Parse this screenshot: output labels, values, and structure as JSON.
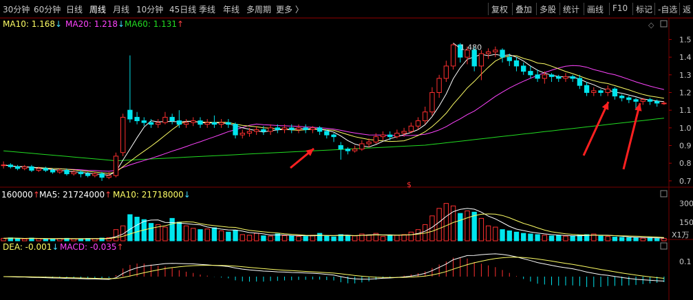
{
  "periods": [
    "30分钟",
    "60分钟",
    "日线",
    "周线",
    "月线",
    "10分钟",
    "45日线",
    "季线",
    "年线",
    "多周期",
    "更多 〉"
  ],
  "active_period": "周线",
  "toolbar": [
    "复权",
    "叠加",
    "多股",
    "统计",
    "画线",
    "F10",
    "标记",
    "-自选",
    "返"
  ],
  "ma_legend": {
    "ma10": {
      "label": "MA10: 1.168",
      "arrow": "↓",
      "color": "#ffff66"
    },
    "ma20": {
      "label": "MA20: 1.218",
      "arrow": "↓",
      "color": "#ff44ff"
    },
    "ma60": {
      "label": "MA60: 1.131",
      "arrow": "↑",
      "color": "#22dd22"
    }
  },
  "vol_legend": {
    "vol": {
      "label": "160000",
      "arrow": "↑",
      "color": "#ffffff"
    },
    "ma5": {
      "label": "MA5: 21724000",
      "arrow": "↑",
      "color": "#ffffff"
    },
    "ma10": {
      "label": "MA10: 21718000",
      "arrow": "↓",
      "color": "#ffff66"
    }
  },
  "macd_legend": {
    "dea": {
      "label": "DEA: -0.001",
      "arrow": "↓",
      "color": "#ffff66"
    },
    "macd": {
      "label": "MACD: -0.035",
      "arrow": "↑",
      "color": "#ff44ff"
    }
  },
  "price_axis": [
    "1.5",
    "1.4",
    "1.3",
    "1.2",
    "1.1",
    "1.0",
    "0.9",
    "0.8",
    "0.7"
  ],
  "vol_axis": [
    "300",
    "150"
  ],
  "vol_unit": "X1万",
  "macd_axis": [
    "0.1"
  ],
  "high_label": "1.480",
  "marker": "$",
  "colors": {
    "up": "#ff3030",
    "down": "#00e5ee",
    "ma10": "#ffff66",
    "ma20": "#ff44ff",
    "ma60": "#22dd22",
    "white": "#ffffff"
  },
  "chart_data": {
    "type": "candlestick",
    "series": [
      {
        "name": "MA10",
        "last": 1.168
      },
      {
        "name": "MA20",
        "last": 1.218
      },
      {
        "name": "MA60",
        "last": 1.131
      }
    ],
    "high_value": 1.48,
    "ylim": [
      0.68,
      1.56
    ],
    "candles": [
      [
        0.79,
        0.79,
        0.77,
        0.81
      ],
      [
        0.79,
        0.78,
        0.77,
        0.8
      ],
      [
        0.78,
        0.77,
        0.76,
        0.79
      ],
      [
        0.77,
        0.78,
        0.76,
        0.79
      ],
      [
        0.78,
        0.76,
        0.75,
        0.79
      ],
      [
        0.76,
        0.77,
        0.75,
        0.78
      ],
      [
        0.77,
        0.76,
        0.75,
        0.78
      ],
      [
        0.76,
        0.75,
        0.74,
        0.77
      ],
      [
        0.75,
        0.76,
        0.74,
        0.77
      ],
      [
        0.76,
        0.74,
        0.73,
        0.77
      ],
      [
        0.74,
        0.75,
        0.73,
        0.76
      ],
      [
        0.75,
        0.74,
        0.72,
        0.76
      ],
      [
        0.74,
        0.73,
        0.72,
        0.75
      ],
      [
        0.73,
        0.74,
        0.72,
        0.75
      ],
      [
        0.74,
        0.72,
        0.7,
        0.75
      ],
      [
        0.72,
        0.73,
        0.71,
        0.75
      ],
      [
        0.73,
        0.84,
        0.72,
        0.86
      ],
      [
        0.86,
        1.06,
        0.84,
        1.08
      ],
      [
        1.1,
        1.05,
        1.03,
        1.41
      ],
      [
        1.06,
        1.04,
        1.02,
        1.09
      ],
      [
        1.04,
        1.03,
        1.01,
        1.06
      ],
      [
        1.03,
        1.02,
        1.0,
        1.05
      ],
      [
        1.02,
        1.03,
        1.0,
        1.05
      ],
      [
        1.03,
        1.06,
        1.02,
        1.09
      ],
      [
        1.06,
        1.04,
        1.02,
        1.08
      ],
      [
        1.04,
        1.02,
        1.0,
        1.1
      ],
      [
        1.02,
        1.03,
        1.0,
        1.05
      ],
      [
        1.03,
        1.04,
        1.01,
        1.06
      ],
      [
        1.04,
        1.02,
        1.0,
        1.06
      ],
      [
        1.02,
        1.03,
        1.0,
        1.05
      ],
      [
        1.03,
        1.02,
        1.0,
        1.07
      ],
      [
        1.02,
        1.03,
        1.0,
        1.05
      ],
      [
        1.03,
        1.02,
        1.0,
        1.05
      ],
      [
        1.02,
        0.96,
        0.94,
        1.03
      ],
      [
        0.96,
        0.97,
        0.94,
        0.99
      ],
      [
        0.97,
        0.98,
        0.95,
        1.0
      ],
      [
        0.98,
        0.99,
        0.96,
        1.01
      ],
      [
        0.99,
        0.98,
        0.96,
        1.01
      ],
      [
        0.98,
        1.0,
        0.96,
        1.02
      ],
      [
        1.0,
        0.99,
        0.97,
        1.02
      ],
      [
        0.99,
        1.0,
        0.97,
        1.02
      ],
      [
        1.0,
        0.99,
        0.97,
        1.02
      ],
      [
        0.99,
        1.0,
        0.97,
        1.02
      ],
      [
        1.0,
        0.99,
        0.97,
        1.02
      ],
      [
        0.99,
        1.0,
        0.97,
        1.01
      ],
      [
        1.0,
        0.98,
        0.96,
        1.01
      ],
      [
        0.98,
        0.96,
        0.94,
        0.99
      ],
      [
        0.96,
        0.95,
        0.92,
        0.97
      ],
      [
        0.9,
        0.88,
        0.82,
        0.92
      ],
      [
        0.88,
        0.87,
        0.85,
        0.89
      ],
      [
        0.87,
        0.88,
        0.86,
        0.9
      ],
      [
        0.88,
        0.91,
        0.87,
        0.93
      ],
      [
        0.91,
        0.92,
        0.89,
        0.94
      ],
      [
        0.92,
        0.95,
        0.91,
        0.97
      ],
      [
        0.95,
        0.96,
        0.93,
        0.98
      ],
      [
        0.96,
        0.95,
        0.93,
        0.98
      ],
      [
        0.95,
        0.97,
        0.94,
        0.99
      ],
      [
        0.97,
        0.98,
        0.95,
        1.0
      ],
      [
        0.98,
        1.01,
        0.97,
        1.03
      ],
      [
        1.01,
        1.04,
        0.99,
        1.06
      ],
      [
        1.04,
        1.09,
        1.02,
        1.12
      ],
      [
        1.09,
        1.2,
        1.07,
        1.23
      ],
      [
        1.2,
        1.28,
        1.17,
        1.3
      ],
      [
        1.28,
        1.35,
        1.26,
        1.38
      ],
      [
        1.35,
        1.47,
        1.33,
        1.48
      ],
      [
        1.47,
        1.4,
        1.37,
        1.48
      ],
      [
        1.4,
        1.44,
        1.36,
        1.46
      ],
      [
        1.44,
        1.35,
        1.32,
        1.46
      ],
      [
        1.35,
        1.42,
        1.27,
        1.44
      ],
      [
        1.42,
        1.43,
        1.39,
        1.45
      ],
      [
        1.43,
        1.44,
        1.4,
        1.46
      ],
      [
        1.44,
        1.4,
        1.37,
        1.45
      ],
      [
        1.4,
        1.38,
        1.35,
        1.42
      ],
      [
        1.38,
        1.35,
        1.32,
        1.4
      ],
      [
        1.35,
        1.32,
        1.3,
        1.37
      ],
      [
        1.32,
        1.3,
        1.28,
        1.35
      ],
      [
        1.3,
        1.28,
        1.26,
        1.33
      ],
      [
        1.28,
        1.3,
        1.25,
        1.32
      ],
      [
        1.3,
        1.29,
        1.26,
        1.31
      ],
      [
        1.29,
        1.28,
        1.26,
        1.3
      ],
      [
        1.28,
        1.29,
        1.26,
        1.31
      ],
      [
        1.29,
        1.28,
        1.26,
        1.3
      ],
      [
        1.28,
        1.24,
        1.22,
        1.3
      ],
      [
        1.24,
        1.2,
        1.18,
        1.26
      ],
      [
        1.2,
        1.21,
        1.18,
        1.23
      ],
      [
        1.21,
        1.2,
        1.18,
        1.22
      ],
      [
        1.2,
        1.22,
        1.18,
        1.24
      ],
      [
        1.22,
        1.18,
        1.16,
        1.23
      ],
      [
        1.18,
        1.17,
        1.15,
        1.19
      ],
      [
        1.17,
        1.16,
        1.14,
        1.18
      ],
      [
        1.16,
        1.15,
        1.1,
        1.17
      ],
      [
        1.15,
        1.16,
        1.13,
        1.17
      ],
      [
        1.16,
        1.15,
        1.13,
        1.17
      ],
      [
        1.15,
        1.14,
        1.12,
        1.16
      ],
      [
        1.14,
        1.14,
        1.13,
        1.15
      ]
    ],
    "volume": [
      20,
      24,
      18,
      15,
      22,
      17,
      14,
      16,
      18,
      20,
      15,
      17,
      19,
      16,
      22,
      25,
      90,
      120,
      210,
      190,
      170,
      140,
      130,
      110,
      180,
      150,
      120,
      100,
      90,
      95,
      105,
      80,
      70,
      85,
      50,
      45,
      60,
      40,
      38,
      55,
      42,
      40,
      36,
      35,
      45,
      60,
      38,
      32,
      50,
      45,
      40,
      55,
      48,
      60,
      35,
      42,
      44,
      50,
      70,
      90,
      130,
      200,
      260,
      300,
      280,
      220,
      240,
      230,
      180,
      120,
      110,
      90,
      80,
      70,
      60,
      55,
      50,
      45,
      40,
      42,
      38,
      40,
      45,
      50,
      55,
      38,
      35,
      30,
      28,
      25,
      24,
      22,
      26,
      18,
      20
    ]
  }
}
